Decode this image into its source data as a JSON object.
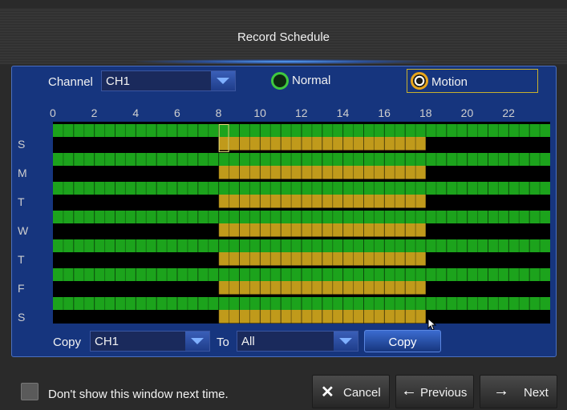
{
  "window": {
    "title": "Record Schedule"
  },
  "channel": {
    "label": "Channel",
    "value": "CH1"
  },
  "modes": {
    "normal_label": "Normal",
    "motion_label": "Motion",
    "selected": "Motion"
  },
  "timeline": {
    "hours": [
      "0",
      "2",
      "4",
      "6",
      "8",
      "10",
      "12",
      "14",
      "16",
      "18",
      "20",
      "22"
    ]
  },
  "schedule": {
    "days": [
      "S",
      "M",
      "T",
      "W",
      "T",
      "F",
      "S"
    ],
    "slots_per_day": 48,
    "motion_start_hour": 8,
    "motion_end_hour": 18,
    "normal_color": "#1ca31c",
    "motion_color": "#c09a1b",
    "empty_color": "#000000"
  },
  "copy": {
    "label": "Copy",
    "from_value": "CH1",
    "to_label": "To",
    "to_value": "All",
    "button_label": "Copy"
  },
  "footer": {
    "checkbox_label": "Don't show this window next time.",
    "cancel_label": "Cancel",
    "previous_label": "Previous",
    "next_label": "Next"
  },
  "icons": {
    "cancel": "close-icon",
    "previous": "arrow-left-icon",
    "next": "arrow-right-icon"
  }
}
